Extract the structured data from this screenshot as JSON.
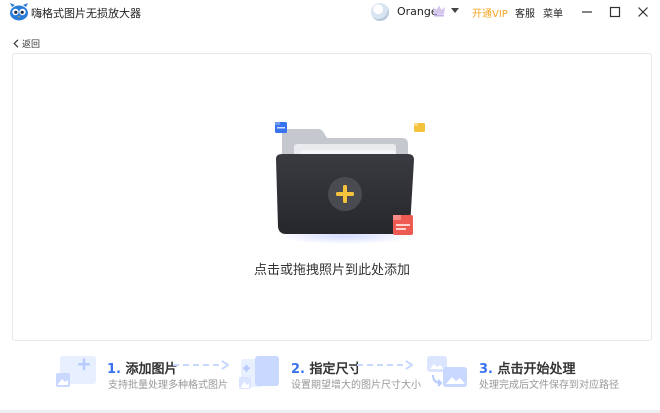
{
  "app": {
    "title": "嗨格式图片无损放大器"
  },
  "header": {
    "username": "Orange",
    "open_vip": "开通VIP",
    "service": "客服",
    "menu": "菜单"
  },
  "nav": {
    "back_label": "返回"
  },
  "drop": {
    "hint": "点击或拖拽照片到此处添加"
  },
  "steps": [
    {
      "title": "1. 添加图片",
      "number": "1.",
      "name": "添加图片",
      "desc": "支持批量处理多种格式图片"
    },
    {
      "title": "2. 指定尺寸",
      "number": "2.",
      "name": "指定尺寸",
      "desc": "设置期望增大的图片尺寸大小"
    },
    {
      "title": "3. 点击开始处理",
      "number": "3.",
      "name": "点击开始处理",
      "desc": "处理完成后文件保存到对应路径"
    }
  ],
  "colors": {
    "accent": "#3a73f0",
    "vip": "#f5a623",
    "plus": "#f5c33b",
    "folder": "#2f3034"
  }
}
